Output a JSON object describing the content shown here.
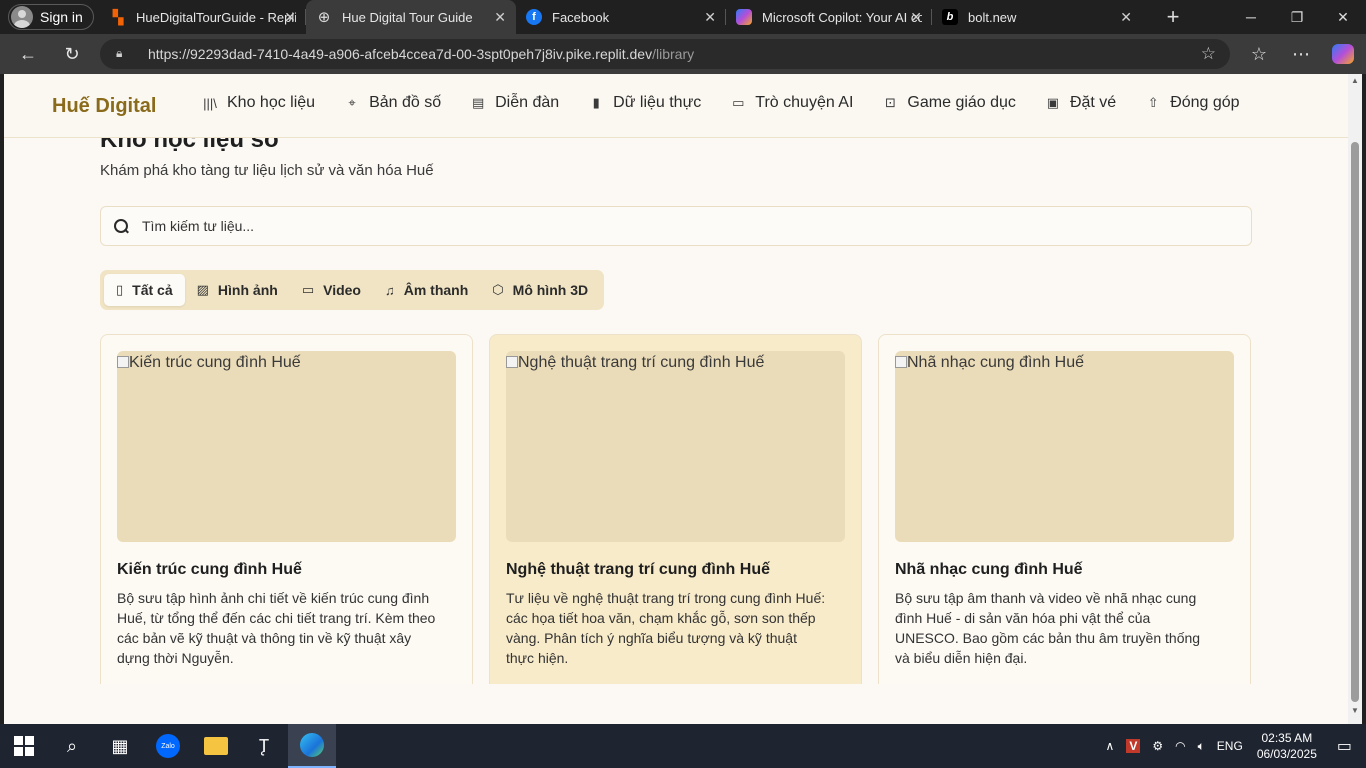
{
  "browser": {
    "signin_label": "Sign in",
    "tabs": [
      {
        "title": "HueDigitalTourGuide - Replit",
        "icon": "replit-icon",
        "active": false
      },
      {
        "title": "Hue Digital Tour Guide",
        "icon": "globe-icon",
        "active": true
      },
      {
        "title": "Facebook",
        "icon": "facebook-icon",
        "active": false
      },
      {
        "title": "Microsoft Copilot: Your AI co",
        "icon": "copilot-icon",
        "active": false
      },
      {
        "title": "bolt.new",
        "icon": "bolt-icon",
        "active": false
      }
    ],
    "url_host": "https://92293dad-7410-4a49-a906-afceb4ccea7d-00-3spt0peh7j8iv.pike.replit.dev",
    "url_path": "/library"
  },
  "site": {
    "logo": "Huế Digital",
    "nav": [
      {
        "label": "Kho học liệu",
        "icon": "library-icon"
      },
      {
        "label": "Bản đồ số",
        "icon": "map-pin-icon"
      },
      {
        "label": "Diễn đàn",
        "icon": "document-icon"
      },
      {
        "label": "Dữ liệu thực",
        "icon": "bar-chart-icon"
      },
      {
        "label": "Trò chuyện AI",
        "icon": "chat-icon"
      },
      {
        "label": "Game giáo dục",
        "icon": "gamepad-icon"
      },
      {
        "label": "Đặt vé",
        "icon": "ticket-icon"
      },
      {
        "label": "Đóng góp",
        "icon": "upload-icon"
      }
    ]
  },
  "library": {
    "title": "Kho học liệu số",
    "subtitle": "Khám phá kho tàng tư liệu lịch sử và văn hóa Huế",
    "search_placeholder": "Tìm kiếm tư liệu...",
    "filters": [
      {
        "label": "Tất cả",
        "icon": "book-icon",
        "active": true
      },
      {
        "label": "Hình ảnh",
        "icon": "image-icon",
        "active": false
      },
      {
        "label": "Video",
        "icon": "video-icon",
        "active": false
      },
      {
        "label": "Âm thanh",
        "icon": "headphones-icon",
        "active": false
      },
      {
        "label": "Mô hình 3D",
        "icon": "cube-icon",
        "active": false
      }
    ],
    "cards": [
      {
        "image_alt": "Kiến trúc cung đình Huế",
        "title": "Kiến trúc cung đình Huế",
        "description": "Bộ sưu tập hình ảnh chi tiết về kiến trúc cung đình Huế, từ tổng thể đến các chi tiết trang trí. Kèm theo các bản vẽ kỹ thuật và thông tin về kỹ thuật xây dựng thời Nguyễn."
      },
      {
        "image_alt": "Nghệ thuật trang trí cung đình Huế",
        "title": "Nghệ thuật trang trí cung đình Huế",
        "description": "Tư liệu về nghệ thuật trang trí trong cung đình Huế: các họa tiết hoa văn, chạm khắc gỗ, sơn son thếp vàng. Phân tích ý nghĩa biểu tượng và kỹ thuật thực hiện."
      },
      {
        "image_alt": "Nhã nhạc cung đình Huế",
        "title": "Nhã nhạc cung đình Huế",
        "description": "Bộ sưu tập âm thanh và video về nhã nhạc cung đình Huế - di sản văn hóa phi vật thể của UNESCO. Bao gồm các bản thu âm truyền thống và biểu diễn hiện đại."
      }
    ]
  },
  "taskbar": {
    "language": "ENG",
    "time": "02:35 AM",
    "date": "06/03/2025"
  }
}
